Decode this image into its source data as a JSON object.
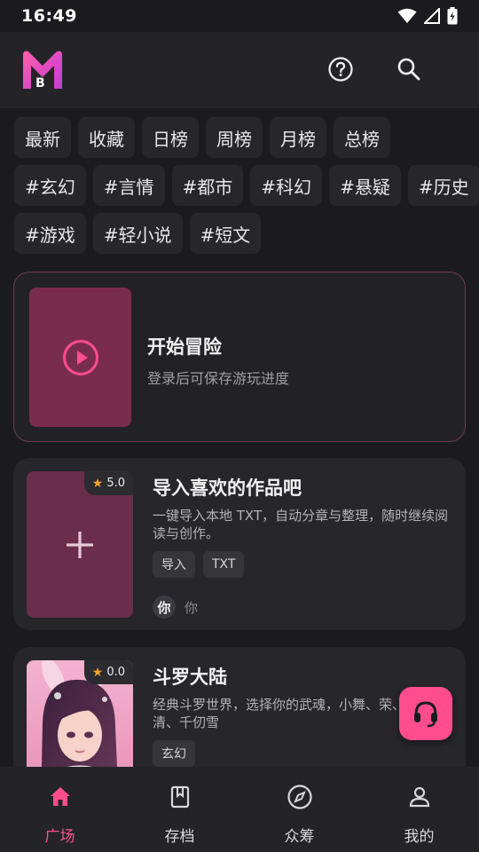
{
  "status_bar": {
    "time": "16:49"
  },
  "header": {
    "logo_text": "B",
    "help_icon": "help-circle-icon",
    "search_icon": "search-icon"
  },
  "tag_rows": [
    [
      "最新",
      "收藏",
      "日榜",
      "周榜",
      "月榜",
      "总榜"
    ],
    [
      "#玄幻",
      "#言情",
      "#都市",
      "#科幻",
      "#悬疑",
      "#历史"
    ],
    [
      "#游戏",
      "#轻小说",
      "#短文"
    ]
  ],
  "adventure": {
    "title": "开始冒险",
    "subtitle": "登录后可保存游玩进度"
  },
  "works": [
    {
      "rating": "5.0",
      "title": "导入喜欢的作品吧",
      "description": "一键导入本地 TXT，自动分章与整理，随时继续阅读与创作。",
      "tags": [
        "导入",
        "TXT"
      ],
      "author_avatar": "你",
      "author_name": "你"
    },
    {
      "rating": "0.0",
      "title": "斗罗大陆",
      "description": "经典斗罗世界，选择你的武魂，小舞、荣、朱竹清、千仞雪",
      "tags": [
        "玄幻"
      ]
    }
  ],
  "nav": [
    {
      "label": "广场",
      "icon": "home-icon",
      "active": true
    },
    {
      "label": "存档",
      "icon": "bookmark-book-icon"
    },
    {
      "label": "众筹",
      "icon": "compass-icon"
    },
    {
      "label": "我的",
      "icon": "person-icon"
    }
  ],
  "colors": {
    "accent": "#ff4d8d",
    "background": "#1b1b1f",
    "card": "#26262b",
    "thumb": "#7a2c4c"
  }
}
